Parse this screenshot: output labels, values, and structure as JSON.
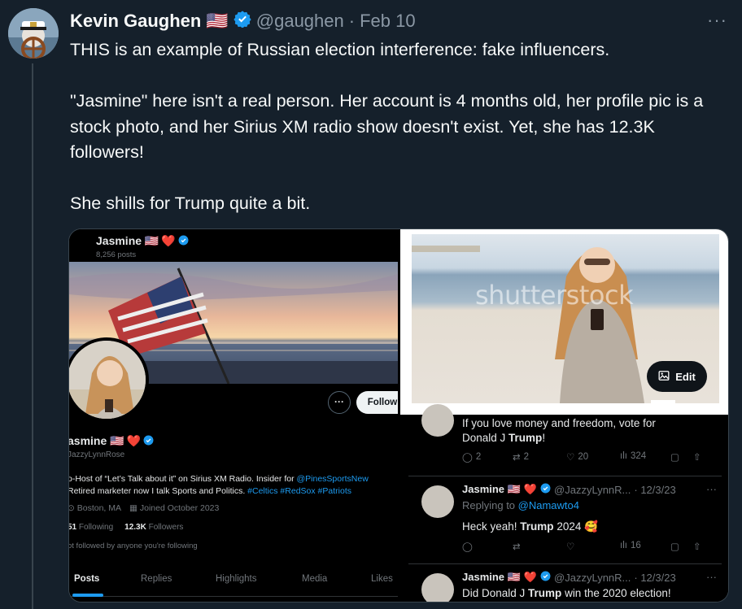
{
  "tweet": {
    "author_name": "Kevin Gaughen",
    "flag": "🇺🇸",
    "handle": "@gaughen",
    "separator": "·",
    "date": "Feb 10",
    "more": "···",
    "text": "THIS is an example of Russian election interference: fake influencers.\n\n\"Jasmine\" here isn't a real person. Her account is 4 months old, her profile pic is a stock photo, and her Sirius XM radio show doesn't exist. Yet, she has 12.3K followers!\n\nShe shills for Trump quite a bit.",
    "icons": [
      "verified-badge-icon",
      "more-icon"
    ],
    "colors": {
      "background": "#15202b",
      "text": "#f7f9f9",
      "muted": "#8b98a5",
      "accent": "#1d9bf0"
    }
  },
  "profile": {
    "top_name": "Jasmine 🇺🇸",
    "heart": "❤️",
    "posts_count": "8,256 posts",
    "more_btn": "···",
    "follow_btn": "Follow",
    "display_name": "asmine 🇺🇸",
    "handle": "JazzyLynnRose",
    "bio_line1_a": "o-Host of “Let’s Talk about it” on Sirius XM Radio. Insider for ",
    "bio_line1_link": "@PinesSportsNew",
    "bio_line2_a": "Retired marketer now I talk Sports and Politics. ",
    "bio_line2_tags": "#Celtics #RedSox #Patriots",
    "location": "Boston, MA",
    "joined": "Joined October 2023",
    "following_count": "51",
    "following_label": "Following",
    "followers_count": "12.3K",
    "followers_label": "Followers",
    "not_followed": "ot followed by anyone you're following",
    "tabs": [
      "Posts",
      "Replies",
      "Highlights",
      "Media",
      "Likes"
    ]
  },
  "stock": {
    "watermark": "shutterstock",
    "edit_label": "Edit"
  },
  "feed": {
    "partial_text_1": "If you love money and freedom, vote for",
    "partial_text_2a": "Donald J ",
    "partial_text_2b": "Trump",
    "partial_text_2c": "!",
    "row1_actions": {
      "replies": "2",
      "reposts": "2",
      "likes": "20",
      "views": "324"
    },
    "t2": {
      "name": "Jasmine 🇺🇸",
      "heart": "❤️",
      "handle": "@JazzyLynnR...",
      "date": "· 12/3/23",
      "more": "···",
      "reply_prefix": "Replying to ",
      "reply_to": "@Namawto4",
      "text_a": "Heck yeah! ",
      "text_b": "Trump",
      "text_c": " 2024 🥰",
      "views": "16"
    },
    "t3": {
      "name": "Jasmine 🇺🇸",
      "heart": "❤️",
      "handle": "@JazzyLynnR...",
      "date": "· 12/3/23",
      "more": "···",
      "text_a": "Did Donald J ",
      "text_b": "Trump",
      "text_c": " win the 2020 election!"
    }
  }
}
